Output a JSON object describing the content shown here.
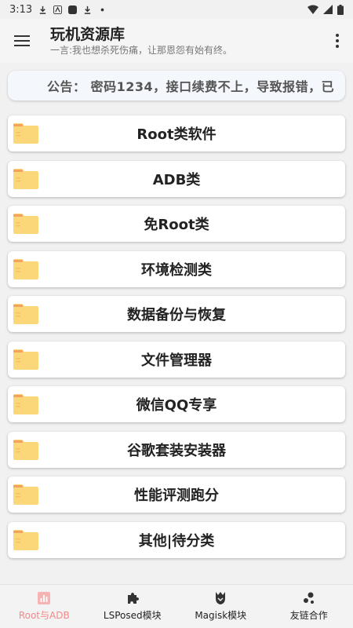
{
  "status_bar": {
    "time": "3:13"
  },
  "app_bar": {
    "title": "玩机资源库",
    "subtitle": "一言:我也想杀死伤痛，让那恩怨有始有终。"
  },
  "notice": {
    "text": "公告： 密码1234，接口续费不上，导致报错，已"
  },
  "categories": [
    {
      "label": "Root类软件"
    },
    {
      "label": "ADB类"
    },
    {
      "label": "免Root类"
    },
    {
      "label": "环境检测类"
    },
    {
      "label": "数据备份与恢复"
    },
    {
      "label": "文件管理器"
    },
    {
      "label": "微信QQ专享"
    },
    {
      "label": "谷歌套装安装器"
    },
    {
      "label": "性能评测跑分"
    },
    {
      "label": "其他|待分类"
    }
  ],
  "bottom_nav": [
    {
      "label": "Root与ADB",
      "icon": "chart-icon",
      "active": true
    },
    {
      "label": "LSPosed模块",
      "icon": "puzzle-icon",
      "active": false
    },
    {
      "label": "Magisk模块",
      "icon": "magisk-icon",
      "active": false
    },
    {
      "label": "友链合作",
      "icon": "dots-icon",
      "active": false
    }
  ],
  "colors": {
    "accent": "#f08a8a",
    "folder": "#fcd77a",
    "folder_tab": "#f4a35c"
  }
}
